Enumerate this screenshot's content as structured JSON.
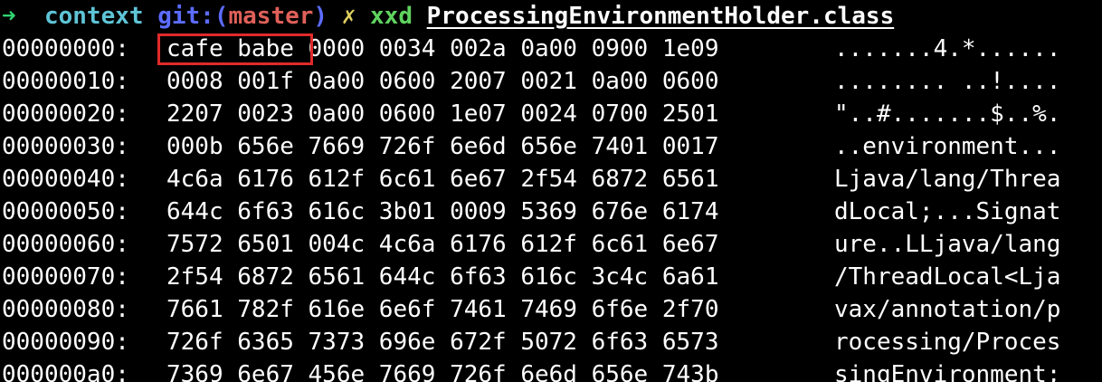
{
  "prompt": {
    "arrow": "➜",
    "directory": "context",
    "git_label": "git:(",
    "branch": "master",
    "git_close": ")",
    "status_mark": "✗",
    "command": "xxd",
    "filename": "ProcessingEnvironmentHolder.class"
  },
  "dump": [
    {
      "addr": "00000000:",
      "hex": "cafe babe 0000 0034 002a 0a00 0900 1e09",
      "ascii": ".......4.*......"
    },
    {
      "addr": "00000010:",
      "hex": "0008 001f 0a00 0600 2007 0021 0a00 0600",
      "ascii": "........ ..!...."
    },
    {
      "addr": "00000020:",
      "hex": "2207 0023 0a00 0600 1e07 0024 0700 2501",
      "ascii": "\"..#.......$..%."
    },
    {
      "addr": "00000030:",
      "hex": "000b 656e 7669 726f 6e6d 656e 7401 0017",
      "ascii": "..environment..."
    },
    {
      "addr": "00000040:",
      "hex": "4c6a 6176 612f 6c61 6e67 2f54 6872 6561",
      "ascii": "Ljava/lang/Threa"
    },
    {
      "addr": "00000050:",
      "hex": "644c 6f63 616c 3b01 0009 5369 676e 6174",
      "ascii": "dLocal;...Signat"
    },
    {
      "addr": "00000060:",
      "hex": "7572 6501 004c 4c6a 6176 612f 6c61 6e67",
      "ascii": "ure..LLjava/lang"
    },
    {
      "addr": "00000070:",
      "hex": "2f54 6872 6561 644c 6f63 616c 3c4c 6a61",
      "ascii": "/ThreadLocal<Lja"
    },
    {
      "addr": "00000080:",
      "hex": "7661 782f 616e 6e6f 7461 7469 6f6e 2f70",
      "ascii": "vax/annotation/p"
    },
    {
      "addr": "00000090:",
      "hex": "726f 6365 7373 696e 672f 5072 6f63 6573",
      "ascii": "rocessing/Proces"
    },
    {
      "addr": "000000a0:",
      "hex": "7369 6e67 456e 7669 726f 6e6d 656e 743b",
      "ascii": "singEnvironment;"
    }
  ],
  "colors": {
    "background": "#000000",
    "text": "#ffffff",
    "highlight_box": "#e02a2a"
  }
}
